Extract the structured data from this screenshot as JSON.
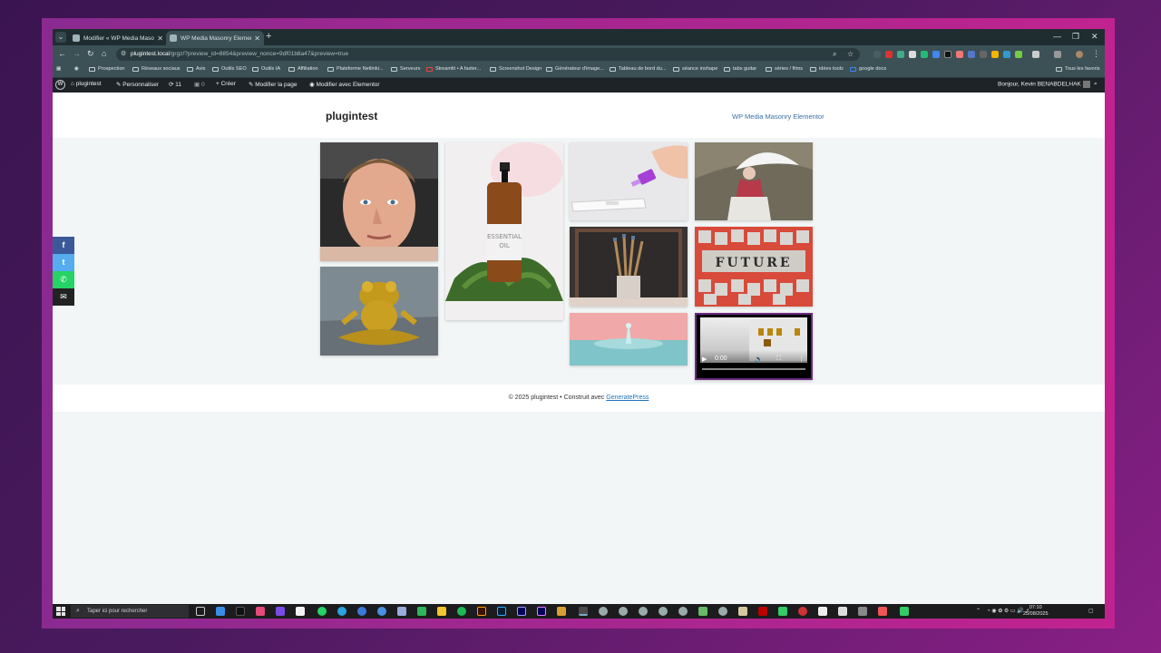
{
  "browser": {
    "tabs": [
      {
        "title": "Modifier « WP Media Masonry",
        "active": false
      },
      {
        "title": "WP Media Masonry Elementor",
        "active": true
      }
    ],
    "url_host": "plugintest.local",
    "url_path": "/grgz/?preview_id=8854&preview_nonce=9df01b8a47&preview=true",
    "bookmarks": [
      "Prospection",
      "Réseaux sociaux",
      "Avis",
      "Outils SEO",
      "Outils IA",
      "Affiliation",
      "Plateforme Netlinki...",
      "Serveurs",
      "Streamlit • A faster...",
      "Screenshot Design",
      "Générateur d'image...",
      "Tableau de bord du...",
      "séance inshape",
      "tabs guitar",
      "séries / films",
      "idées tools",
      "google docs"
    ],
    "all_favorites": "Tous les favoris"
  },
  "wpbar": {
    "site": "plugintest",
    "customize": "Personnaliser",
    "updates": "11",
    "comments": "0",
    "create": "Créer",
    "edit_page": "Modifier la page",
    "edit_elementor": "Modifier avec Elementor",
    "greeting": "Bonjour, Kevin BENABDELHAK"
  },
  "site": {
    "title": "plugintest",
    "nav_link": "WP Media Masonry Elementor"
  },
  "gallery": {
    "video_time": "0:00",
    "tile_word": "FUTURE",
    "bottle_label_1": "ESSENTIAL",
    "bottle_label_2": "OIL"
  },
  "footer": {
    "prefix": "© 2025 plugintest • Construit avec ",
    "link": "GeneratePress"
  },
  "taskbar": {
    "search_placeholder": "Taper ici pour rechercher",
    "time": "07:10",
    "date": "25/08/2025"
  },
  "colors": {
    "wp_admin_bar": "#1d2327",
    "chrome_toolbar": "#3b5156",
    "link_blue": "#1e73be",
    "facebook": "#3b5998",
    "twitter": "#55acee",
    "whatsapp": "#25d366",
    "email": "#222222"
  }
}
